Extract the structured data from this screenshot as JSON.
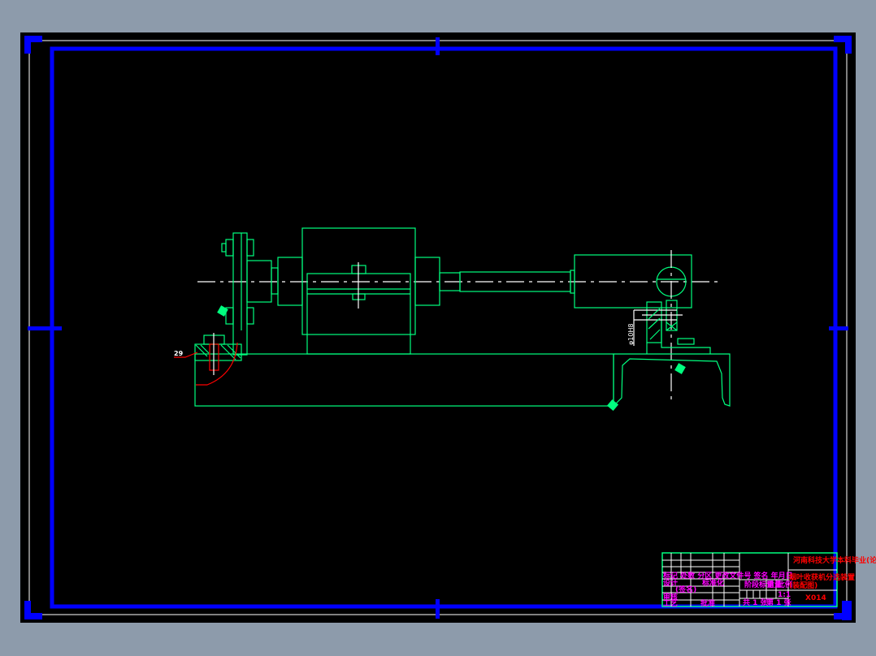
{
  "drawing": {
    "part_label": "29",
    "dimension_text": "φ10H8",
    "colors": {
      "background": "#000000",
      "frame": "#0000ff",
      "geometry": "#00ff7f",
      "centerline": "#ffffff",
      "hatch_marks": "#ff0000",
      "title_text": "#ff00ff",
      "school_text": "#ff0000",
      "viewport_surround": "#8d9bab"
    }
  },
  "title_block": {
    "school": "河南科技大学本科毕业(论文)",
    "drawing_name_line1": "烟叶收获机分选装置",
    "drawing_name_line2": "(装配图)",
    "drawing_number": "X014",
    "revision_header": "标记 处数 分区 更改文件号 签名 年月日",
    "design": "设计",
    "signature": "(签名)",
    "standardization": "标准化",
    "review": "审核",
    "process": "工艺",
    "approve": "批准",
    "stage_mark": "阶段标记",
    "weight": "重量",
    "scale_label": "比例",
    "scale": "1:1",
    "sheets_total": "共 1 张",
    "sheet_no": "第 1 张"
  }
}
